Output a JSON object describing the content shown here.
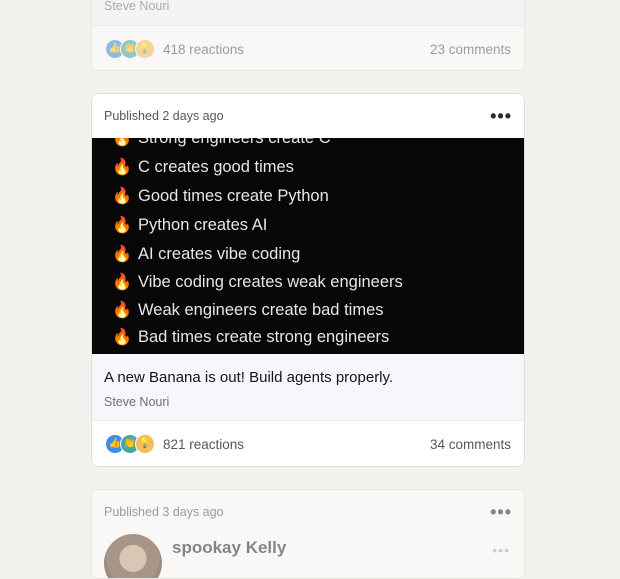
{
  "top_card": {
    "author": "Steve Nouri",
    "reactions": "418 reactions",
    "comments": "23 comments"
  },
  "main_card": {
    "published": "Published 2 days ago",
    "more": "•••",
    "media_lines": [
      "Strong engineers create C",
      "C creates good times",
      "Good times create Python",
      "Python creates AI",
      "AI creates vibe coding",
      "Vibe coding creates weak engineers",
      "Weak engineers create bad times",
      "Bad times create strong engineers"
    ],
    "fire_glyph": "🔥",
    "caption": "A new Banana is out! Build agents properly.",
    "author": "Steve Nouri",
    "reactions": "821 reactions",
    "comments": "34 comments",
    "reaction_icons": [
      "like-icon",
      "celebrate-icon",
      "insight-icon"
    ]
  },
  "bottom_card": {
    "published": "Published 3 days ago",
    "more": "•••",
    "name": "spookay Kelly",
    "more_small": "•••"
  },
  "colors": {
    "background": "#f2f1ed",
    "card": "#ffffff",
    "like": "#378fe9",
    "celebrate": "#44a8a0",
    "insight": "#f5bb5c",
    "media_bg": "#070707"
  }
}
